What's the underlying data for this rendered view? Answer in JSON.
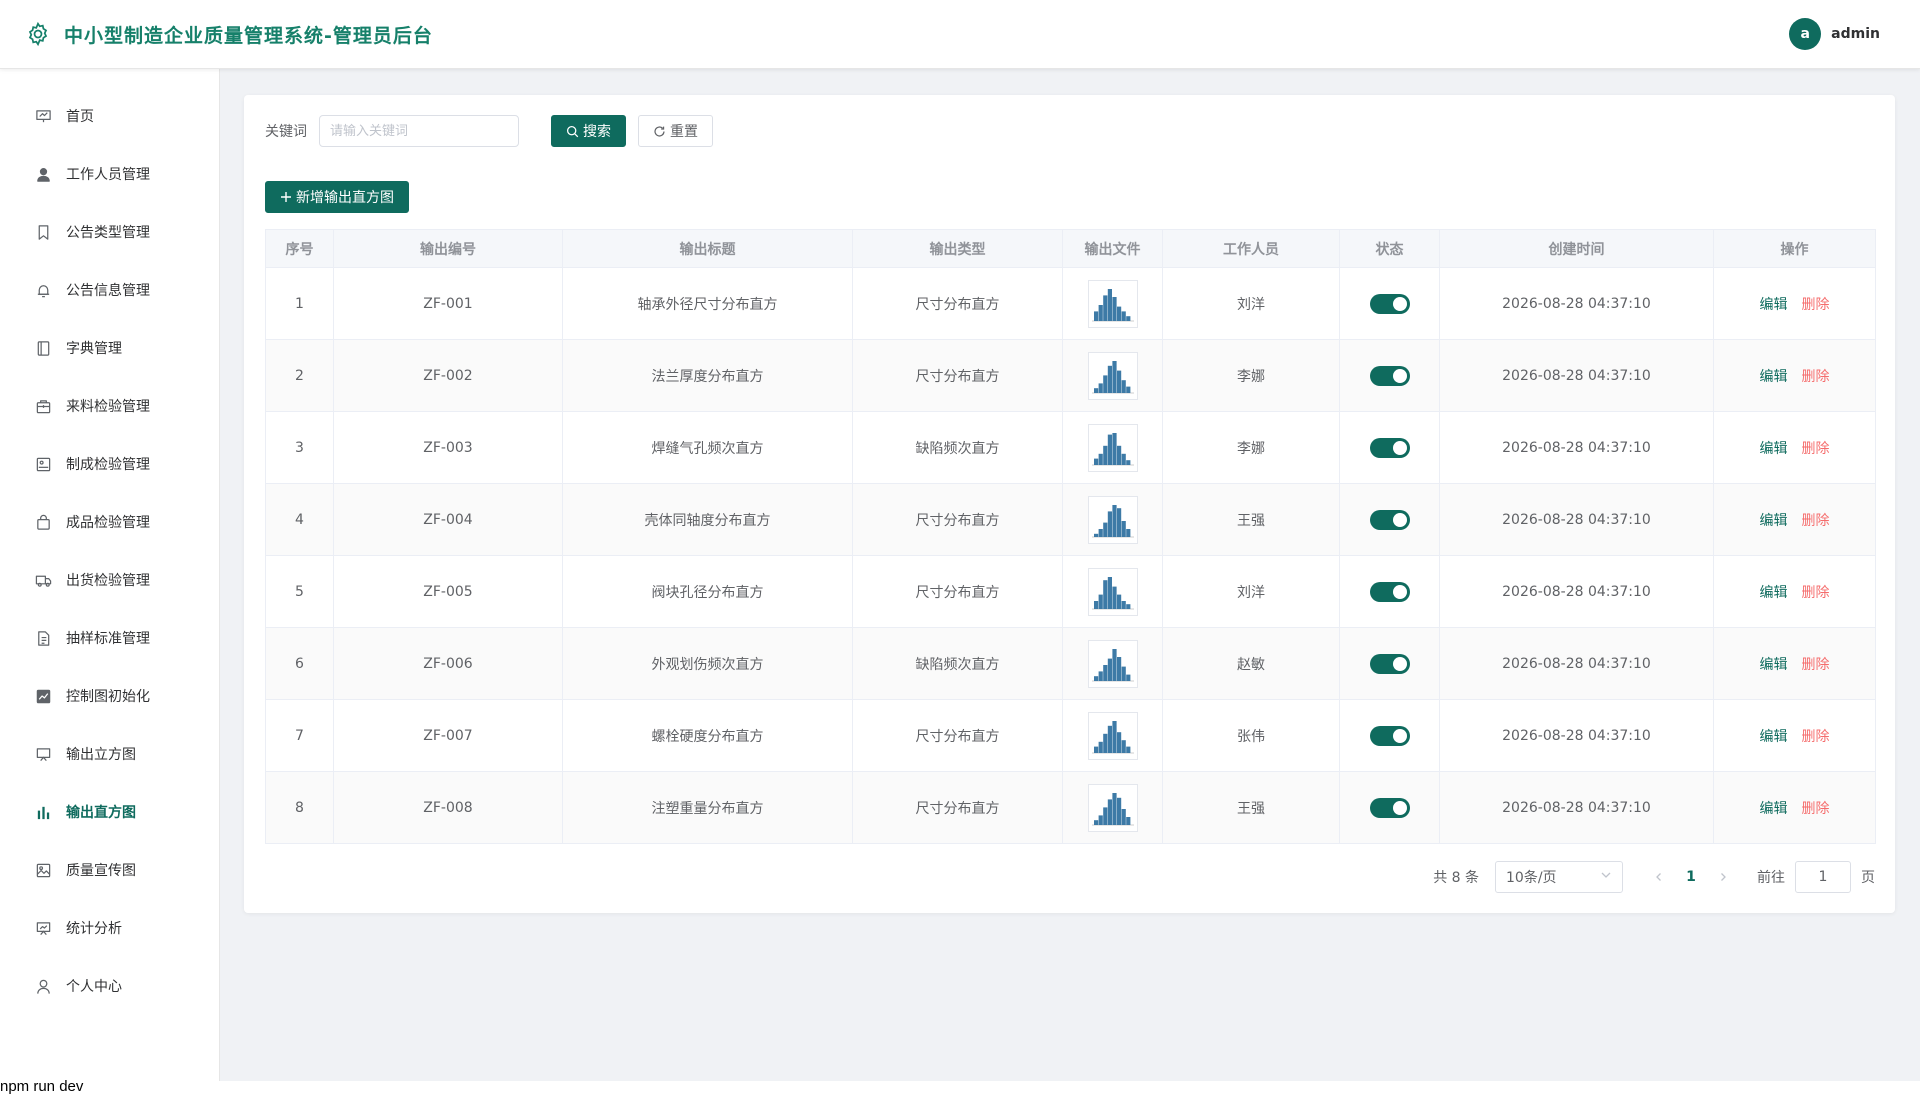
{
  "header": {
    "title": "中小型制造企业质量管理系统-管理员后台",
    "avatar_letter": "a",
    "username": "admin"
  },
  "colors": {
    "accent": "#0f6b5e",
    "danger": "#f56c6c",
    "header_title": "#16806a"
  },
  "sidebar": {
    "items": [
      {
        "label": "首页",
        "icon": "home-icon",
        "active": false
      },
      {
        "label": "工作人员管理",
        "icon": "user-icon",
        "active": false
      },
      {
        "label": "公告类型管理",
        "icon": "bookmark-icon",
        "active": false
      },
      {
        "label": "公告信息管理",
        "icon": "bell-icon",
        "active": false
      },
      {
        "label": "字典管理",
        "icon": "notebook-icon",
        "active": false
      },
      {
        "label": "来料检验管理",
        "icon": "box-icon",
        "active": false
      },
      {
        "label": "制成检验管理",
        "icon": "picture-icon",
        "active": false
      },
      {
        "label": "成品检验管理",
        "icon": "bag-icon",
        "active": false
      },
      {
        "label": "出货检验管理",
        "icon": "truck-icon",
        "active": false
      },
      {
        "label": "抽样标准管理",
        "icon": "document-icon",
        "active": false
      },
      {
        "label": "控制图初始化",
        "icon": "chart-line-icon",
        "active": false
      },
      {
        "label": "输出立方图",
        "icon": "presentation-icon",
        "active": false
      },
      {
        "label": "输出直方图",
        "icon": "histogram-icon",
        "active": true
      },
      {
        "label": "质量宣传图",
        "icon": "image-icon",
        "active": false
      },
      {
        "label": "统计分析",
        "icon": "board-icon",
        "active": false
      },
      {
        "label": "个人中心",
        "icon": "person-icon",
        "active": false
      }
    ]
  },
  "search": {
    "label": "关键词",
    "placeholder": "请输入关键词",
    "value": "",
    "search_button": "搜索",
    "reset_button": "重置"
  },
  "add_button": "新增输出直方图",
  "table": {
    "columns": [
      "序号",
      "输出编号",
      "输出标题",
      "输出类型",
      "输出文件",
      "工作人员",
      "状态",
      "创建时间",
      "操作"
    ],
    "edit_label": "编辑",
    "delete_label": "删除",
    "rows": [
      {
        "index": "1",
        "code": "ZF-001",
        "title": "轴承外径尺寸分布直方",
        "type": "尺寸分布直方",
        "staff": "刘洋",
        "created": "2026-08-28 04:37:10",
        "enabled": true,
        "bars": [
          0.3,
          0.5,
          0.8,
          1.0,
          0.75,
          0.45,
          0.3,
          0.15
        ]
      },
      {
        "index": "2",
        "code": "ZF-002",
        "title": "法兰厚度分布直方",
        "type": "尺寸分布直方",
        "staff": "李娜",
        "created": "2026-08-28 04:37:10",
        "enabled": true,
        "bars": [
          0.15,
          0.3,
          0.55,
          0.85,
          1.0,
          0.7,
          0.4,
          0.2
        ]
      },
      {
        "index": "3",
        "code": "ZF-003",
        "title": "焊缝气孔频次直方",
        "type": "缺陷频次直方",
        "staff": "李娜",
        "created": "2026-08-28 04:37:10",
        "enabled": true,
        "bars": [
          0.2,
          0.35,
          0.6,
          0.95,
          1.0,
          0.6,
          0.35,
          0.15
        ]
      },
      {
        "index": "4",
        "code": "ZF-004",
        "title": "壳体同轴度分布直方",
        "type": "尺寸分布直方",
        "staff": "王强",
        "created": "2026-08-28 04:37:10",
        "enabled": true,
        "bars": [
          0.1,
          0.25,
          0.45,
          0.8,
          1.0,
          0.9,
          0.5,
          0.25
        ]
      },
      {
        "index": "5",
        "code": "ZF-005",
        "title": "阀块孔径分布直方",
        "type": "尺寸分布直方",
        "staff": "刘洋",
        "created": "2026-08-28 04:37:10",
        "enabled": true,
        "bars": [
          0.25,
          0.45,
          0.9,
          1.0,
          0.7,
          0.45,
          0.25,
          0.15
        ]
      },
      {
        "index": "6",
        "code": "ZF-006",
        "title": "外观划伤频次直方",
        "type": "缺陷频次直方",
        "staff": "赵敏",
        "created": "2026-08-28 04:37:10",
        "enabled": true,
        "bars": [
          0.15,
          0.3,
          0.5,
          0.7,
          1.0,
          0.75,
          0.45,
          0.2
        ]
      },
      {
        "index": "7",
        "code": "ZF-007",
        "title": "螺栓硬度分布直方",
        "type": "尺寸分布直方",
        "staff": "张伟",
        "created": "2026-08-28 04:37:10",
        "enabled": true,
        "bars": [
          0.2,
          0.35,
          0.6,
          0.85,
          1.0,
          0.65,
          0.4,
          0.2
        ]
      },
      {
        "index": "8",
        "code": "ZF-008",
        "title": "注塑重量分布直方",
        "type": "尺寸分布直方",
        "staff": "王强",
        "created": "2026-08-28 04:37:10",
        "enabled": true,
        "bars": [
          0.15,
          0.3,
          0.55,
          0.8,
          1.0,
          0.85,
          0.5,
          0.25
        ]
      }
    ]
  },
  "pagination": {
    "total": "共 8 条",
    "page_size": "10条/页",
    "current_page": "1",
    "goto_label": "前往",
    "goto_value": "1",
    "page_suffix": "页"
  },
  "footer_text": "npm run dev"
}
